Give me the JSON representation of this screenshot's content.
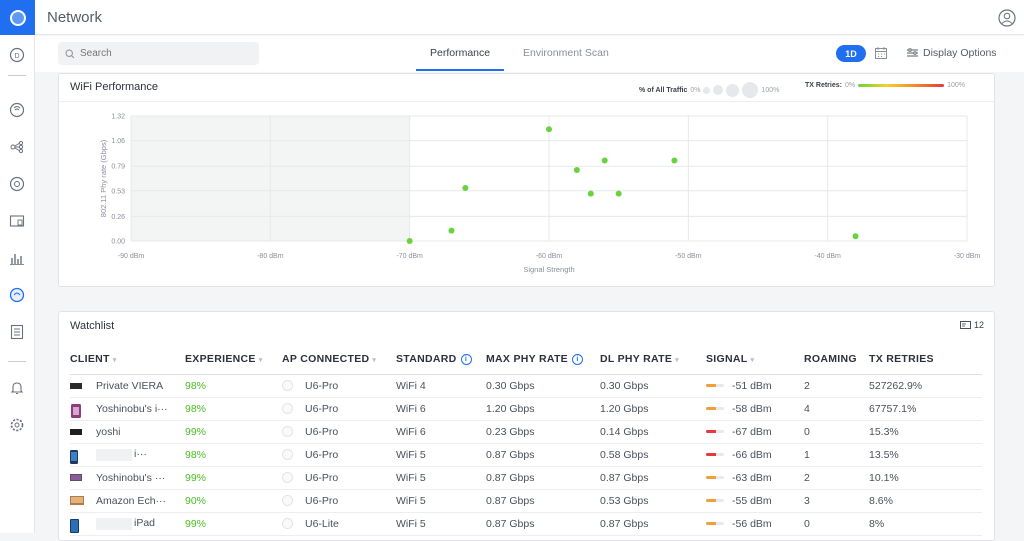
{
  "app": {
    "title": "Network"
  },
  "search": {
    "placeholder": "Search"
  },
  "tabs": [
    {
      "label": "Performance",
      "active": true
    },
    {
      "label": "Environment Scan",
      "active": false
    }
  ],
  "time_range": "1D",
  "display_options_label": "Display Options",
  "sidebar_icons": [
    "dashboard-icon",
    "devices-icon",
    "topology-icon",
    "clients-icon",
    "insights-icon",
    "statistics-icon",
    "wifiman-icon",
    "logs-icon",
    "alerts-icon",
    "settings-icon"
  ],
  "accent_color": "#1f6ff0",
  "wifi_performance": {
    "title": "WiFi Performance",
    "legend_traffic_label": "% of All Traffic",
    "legend_traffic_min": "0%",
    "legend_traffic_max": "100%",
    "legend_retries_label": "TX Retries:",
    "legend_retries_min": "0%",
    "legend_retries_max": "100%"
  },
  "chart_data": {
    "type": "scatter",
    "xlabel": "Signal Strength",
    "ylabel": "802.11 Phy rate (Gbps)",
    "xlim": [
      -90,
      -30
    ],
    "ylim": [
      0,
      1.32
    ],
    "x_ticks": [
      -90,
      -80,
      -70,
      -60,
      -50,
      -40,
      -30
    ],
    "x_tick_labels": [
      "-90 dBm",
      "-80 dBm",
      "-70 dBm",
      "-60 dBm",
      "-50 dBm",
      "-40 dBm",
      "-30 dBm"
    ],
    "y_ticks": [
      0,
      0.26,
      0.53,
      0.79,
      1.06,
      1.32
    ],
    "y_tick_labels": [
      "0.00",
      "0.26",
      "0.53",
      "0.79",
      "1.06",
      "1.32"
    ],
    "shaded_region_x": [
      -90,
      -70
    ],
    "point_color": "#6ad23a",
    "points": [
      {
        "x": -70,
        "y": 0.0
      },
      {
        "x": -67,
        "y": 0.11
      },
      {
        "x": -66,
        "y": 0.56
      },
      {
        "x": -60,
        "y": 1.18
      },
      {
        "x": -58,
        "y": 0.75
      },
      {
        "x": -57,
        "y": 0.5
      },
      {
        "x": -56,
        "y": 0.85
      },
      {
        "x": -55,
        "y": 0.5
      },
      {
        "x": -51,
        "y": 0.85
      },
      {
        "x": -38,
        "y": 0.05
      }
    ]
  },
  "watchlist": {
    "title": "Watchlist",
    "count": "12",
    "columns": [
      "CLIENT",
      "EXPERIENCE",
      "AP CONNECTED",
      "STANDARD",
      "MAX PHY RATE",
      "DL PHY RATE",
      "SIGNAL",
      "ROAMING",
      "TX RETRIES"
    ],
    "rows": [
      {
        "client": "Private VIERA",
        "experience": "98%",
        "ap": "U6-Pro",
        "standard": "WiFi 4",
        "max_phy": "0.30 Gbps",
        "dl_phy": "0.30 Gbps",
        "signal": "-51 dBm",
        "signal_color": "#f0a03a",
        "roaming": "2",
        "tx_retries": "527262.9%"
      },
      {
        "client": "Yoshinobu's i···",
        "experience": "98%",
        "ap": "U6-Pro",
        "standard": "WiFi 6",
        "max_phy": "1.20 Gbps",
        "dl_phy": "1.20 Gbps",
        "signal": "-58 dBm",
        "signal_color": "#f0a03a",
        "roaming": "4",
        "tx_retries": "67757.1%"
      },
      {
        "client": "yoshi",
        "experience": "99%",
        "ap": "U6-Pro",
        "standard": "WiFi 6",
        "max_phy": "0.23 Gbps",
        "dl_phy": "0.14 Gbps",
        "signal": "-67 dBm",
        "signal_color": "#e23b3b",
        "roaming": "0",
        "tx_retries": "15.3%"
      },
      {
        "client": "i···",
        "experience": "98%",
        "ap": "U6-Pro",
        "standard": "WiFi 5",
        "max_phy": "0.87 Gbps",
        "dl_phy": "0.58 Gbps",
        "signal": "-66 dBm",
        "signal_color": "#e23b3b",
        "roaming": "1",
        "tx_retries": "13.5%"
      },
      {
        "client": "Yoshinobu's ···",
        "experience": "99%",
        "ap": "U6-Pro",
        "standard": "WiFi 5",
        "max_phy": "0.87 Gbps",
        "dl_phy": "0.87 Gbps",
        "signal": "-63 dBm",
        "signal_color": "#f0a03a",
        "roaming": "2",
        "tx_retries": "10.1%"
      },
      {
        "client": "Amazon Ech···",
        "experience": "90%",
        "ap": "U6-Pro",
        "standard": "WiFi 5",
        "max_phy": "0.87 Gbps",
        "dl_phy": "0.53 Gbps",
        "signal": "-55 dBm",
        "signal_color": "#f0a03a",
        "roaming": "3",
        "tx_retries": "8.6%"
      },
      {
        "client": "iPad",
        "experience": "99%",
        "ap": "U6-Lite",
        "standard": "WiFi 5",
        "max_phy": "0.87 Gbps",
        "dl_phy": "0.87 Gbps",
        "signal": "-56 dBm",
        "signal_color": "#f0a03a",
        "roaming": "0",
        "tx_retries": "8%"
      }
    ]
  }
}
